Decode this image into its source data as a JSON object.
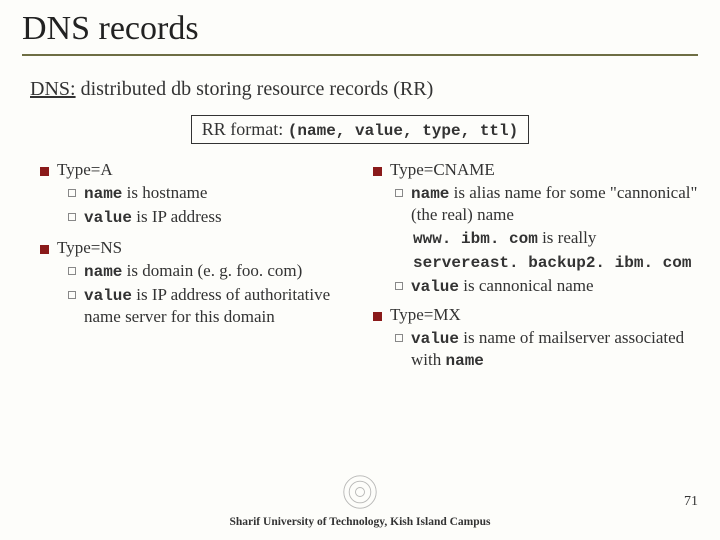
{
  "title": "DNS records",
  "subtitle_prefix": "DNS:",
  "subtitle_rest": " distributed db storing resource records (RR)",
  "rrformat_label": "RR format: ",
  "rrformat_tuple": "(name, value, type, ttl)",
  "left": {
    "typeA": {
      "head": "Type=A",
      "b1_code": "name",
      "b1_rest": " is hostname",
      "b2_code": "value",
      "b2_rest": " is IP address"
    },
    "typeNS": {
      "head": "Type=NS",
      "b1_code": "name",
      "b1_rest": " is domain (e. g. foo. com)",
      "b2_code": "value",
      "b2_rest": " is IP address of authoritative name server for this domain"
    }
  },
  "right": {
    "typeCNAME": {
      "head": "Type=CNAME",
      "b1_code": "name",
      "b1_rest": " is alias name for some \"cannonical\" (the real) name",
      "ex1_code": "www. ibm. com",
      "ex1_rest": " is really",
      "ex2_code": "servereast. backup2. ibm. com",
      "b2_code": "value",
      "b2_rest": " is cannonical name"
    },
    "typeMX": {
      "head": "Type=MX",
      "b1_code": "value",
      "b1_mid": " is name of mailserver associated with ",
      "b1_code2": "name"
    }
  },
  "footer": "Sharif University of Technology, Kish Island Campus",
  "page": "71"
}
